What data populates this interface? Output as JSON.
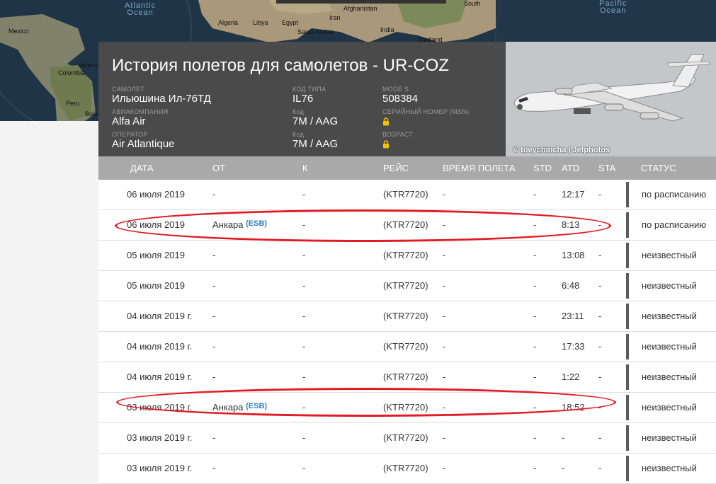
{
  "map": {
    "labels": {
      "atlantic": "Atlantic\nOcean",
      "pacific": "Pacific\nOcean",
      "mexico": "Mexico",
      "venezuela": "Venezu",
      "colombia": "Colombia",
      "peru": "Peru",
      "bolivia": "Boliv",
      "algeria": "Algeria",
      "libya": "Libya",
      "egypt": "Egypt",
      "saudi": "Saudi Arabia",
      "iran": "Iran",
      "afghanistan": "Afghanistan",
      "india": "India",
      "thailand": "Thailand",
      "south": "South"
    }
  },
  "header": {
    "title": "История полетов для самолетов - UR-COZ",
    "aircraft_label": "САМОЛЕТ",
    "aircraft_value": "Ильюшина Ил-76ТД",
    "airline_label": "АВИАКОМПАНИЯ",
    "airline_value": "Alfa Air",
    "operator_label": "ОПЕРАТОР",
    "operator_value": "Air Atlantique",
    "type_code_label": "КОД ТИПА",
    "type_code_value": "IL76",
    "code1_label": "Код",
    "code1_value": "7M / AAG",
    "code2_label": "Код",
    "code2_value": "7M / AAG",
    "modes_label": "MODE S",
    "modes_value": "508384",
    "msn_label": "СЕРИЙНЫЙ НОМЕР (MSN)",
    "age_label": "ВОЗРАСТ",
    "photo_credit": "© toeychincha | Jetphotos"
  },
  "table": {
    "headers": {
      "date": "ДАТА",
      "from": "ОТ",
      "to": "К",
      "flight": "РЕЙС",
      "flight_time": "ВРЕМЯ ПОЛЕТА",
      "std": "STD",
      "atd": "ATD",
      "sta": "STA",
      "status": "СТАТУС"
    },
    "rows": [
      {
        "date": "06 июля 2019",
        "from": "-",
        "from_code": "",
        "to": "-",
        "flight": "(KTR7720)",
        "time": "-",
        "std": "-",
        "atd": "12:17",
        "sta": "-",
        "status": "по расписанию"
      },
      {
        "date": "06 июля 2019",
        "from": "Анкара",
        "from_code": "(ESB)",
        "to": "-",
        "flight": "(KTR7720)",
        "time": "-",
        "std": "-",
        "atd": "8:13",
        "sta": "-",
        "status": "по расписанию"
      },
      {
        "date": "05 июля 2019",
        "from": "-",
        "from_code": "",
        "to": "-",
        "flight": "(KTR7720)",
        "time": "-",
        "std": "-",
        "atd": "13:08",
        "sta": "-",
        "status": "неизвестный"
      },
      {
        "date": "05 июля 2019",
        "from": "-",
        "from_code": "",
        "to": "-",
        "flight": "(KTR7720)",
        "time": "-",
        "std": "-",
        "atd": "6:48",
        "sta": "-",
        "status": "неизвестный"
      },
      {
        "date": "04 июля 2019 г.",
        "from": "-",
        "from_code": "",
        "to": "-",
        "flight": "(KTR7720)",
        "time": "-",
        "std": "-",
        "atd": "23:11",
        "sta": "-",
        "status": "неизвестный"
      },
      {
        "date": "04 июля 2019 г.",
        "from": "-",
        "from_code": "",
        "to": "-",
        "flight": "(KTR7720)",
        "time": "-",
        "std": "-",
        "atd": "17:33",
        "sta": "-",
        "status": "неизвестный"
      },
      {
        "date": "04 июля 2019 г.",
        "from": "-",
        "from_code": "",
        "to": "-",
        "flight": "(KTR7720)",
        "time": "-",
        "std": "-",
        "atd": "1:22",
        "sta": "-",
        "status": "неизвестный"
      },
      {
        "date": "03 июля 2019 г.",
        "from": "Анкара",
        "from_code": "(ESB)",
        "to": "-",
        "flight": "(KTR7720)",
        "time": "-",
        "std": "-",
        "atd": "18:52",
        "sta": "-",
        "status": "неизвестный"
      },
      {
        "date": "03 июля 2019 г.",
        "from": "-",
        "from_code": "",
        "to": "-",
        "flight": "(KTR7720)",
        "time": "-",
        "std": "-",
        "atd": "-",
        "sta": "-",
        "status": "неизвестный"
      },
      {
        "date": "03 июля 2019 г.",
        "from": "-",
        "from_code": "",
        "to": "-",
        "flight": "(KTR7720)",
        "time": "-",
        "std": "-",
        "atd": "-",
        "sta": "-",
        "status": "неизвестный"
      }
    ],
    "highlighted_rows": [
      1,
      7
    ]
  },
  "colors": {
    "header_bg": "#4a4a4a",
    "table_head_bg": "#a9a9a9",
    "highlight": "#e21a22",
    "code_link": "#2b7fc4",
    "lock": "#f3c300"
  }
}
